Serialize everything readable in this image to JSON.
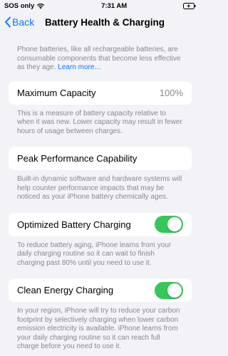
{
  "status": {
    "carrier": "SOS only",
    "time": "7:31 AM"
  },
  "nav": {
    "back_label": "Back",
    "title": "Battery Health & Charging"
  },
  "intro": {
    "text": "Phone batteries, like all rechargeable batteries, are consumable components that become less effective as they age.",
    "link": "Learn more…"
  },
  "max_capacity": {
    "label": "Maximum Capacity",
    "value": "100%",
    "footnote": "This is a measure of battery capacity relative to when it was new. Lower capacity may result in fewer hours of usage between charges."
  },
  "peak_performance": {
    "label": "Peak Performance Capability",
    "footnote": "Built-in dynamic software and hardware systems will help counter performance impacts that may be noticed as your iPhone battery chemically ages."
  },
  "optimized_charging": {
    "label": "Optimized Battery Charging",
    "enabled": true,
    "footnote": "To reduce battery aging, iPhone learns from your daily charging routine so it can wait to finish charging past 80% until you need to use it."
  },
  "clean_energy": {
    "label": "Clean Energy Charging",
    "enabled": true,
    "footnote": "In your region, iPhone will try to reduce your carbon footprint by selectively charging when lower carbon emission electricity is available. iPhone learns from your daily charging routine so it can reach full charge before you need to use it."
  },
  "colors": {
    "accent": "#007aff",
    "toggle_on": "#34c759",
    "background": "#f2f2f7"
  }
}
